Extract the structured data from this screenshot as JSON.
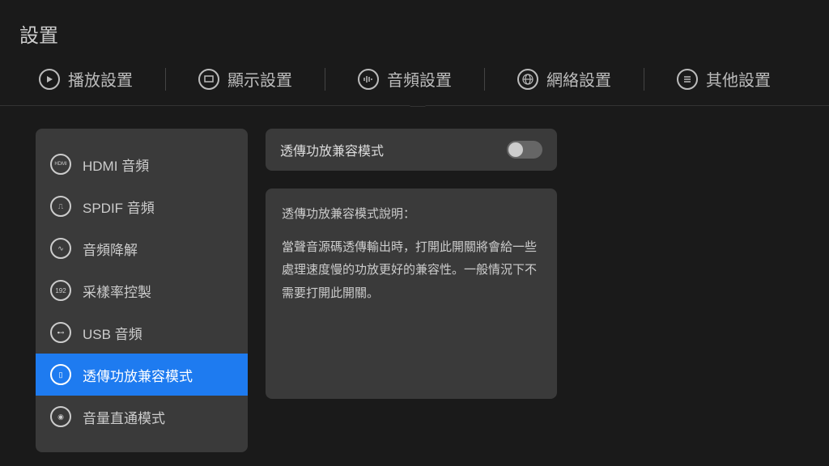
{
  "page_title": "設置",
  "tabs": [
    {
      "label": "播放設置"
    },
    {
      "label": "顯示設置"
    },
    {
      "label": "音頻設置"
    },
    {
      "label": "網絡設置"
    },
    {
      "label": "其他設置"
    }
  ],
  "sidebar": {
    "items": [
      {
        "label": "HDMI 音頻",
        "icon_text": "HDMI"
      },
      {
        "label": "SPDIF 音頻",
        "icon_text": "⎍"
      },
      {
        "label": "音頻降解",
        "icon_text": "∿"
      },
      {
        "label": "采樣率控製",
        "icon_text": "192"
      },
      {
        "label": "USB 音頻",
        "icon_text": "⊷"
      },
      {
        "label": "透傳功放兼容模式",
        "icon_text": "▯"
      },
      {
        "label": "音量直通模式",
        "icon_text": "◉"
      }
    ]
  },
  "right": {
    "toggle_label": "透傳功放兼容模式",
    "desc_title": "透傳功放兼容模式說明：",
    "desc_body": "當聲音源碼透傳輸出時，打開此開關將會給一些處理速度慢的功放更好的兼容性。一般情況下不需要打開此開關。"
  }
}
